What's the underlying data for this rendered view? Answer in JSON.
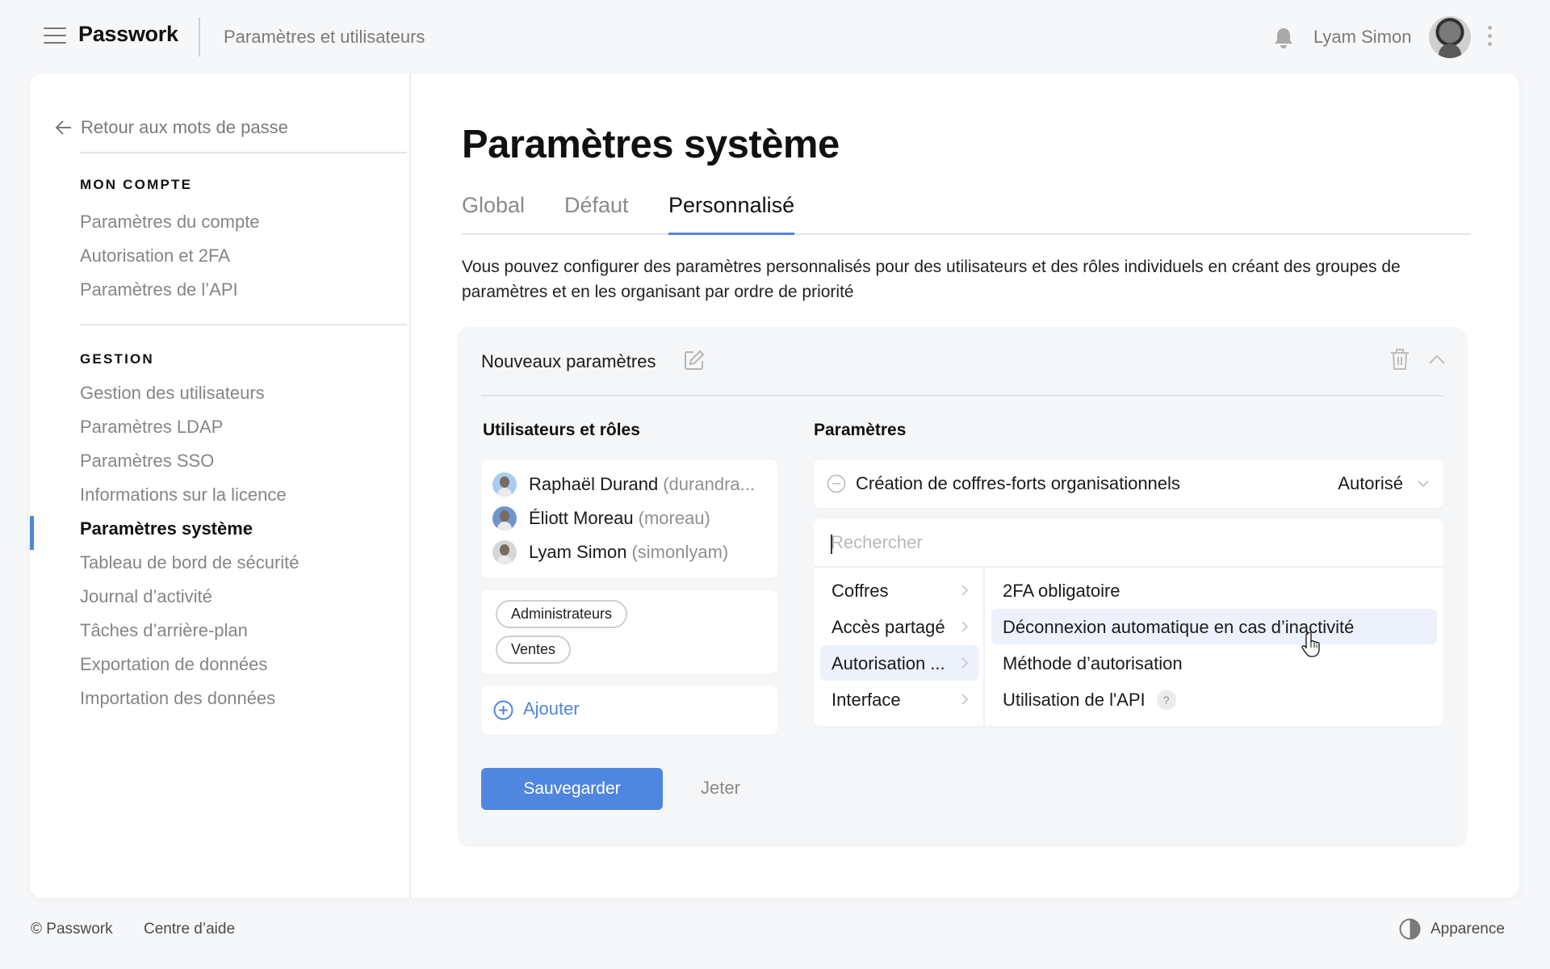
{
  "header": {
    "brand": "Passwork",
    "breadcrumb": "Paramètres et utilisateurs",
    "user_name": "Lyam Simon"
  },
  "sidebar": {
    "back_label": "Retour aux mots de passe",
    "sections": [
      {
        "title": "MON COMPTE",
        "items": [
          {
            "label": "Paramètres du compte",
            "active": false
          },
          {
            "label": "Autorisation et 2FA",
            "active": false
          },
          {
            "label": "Paramètres de l’API",
            "active": false
          }
        ]
      },
      {
        "title": "GESTION",
        "items": [
          {
            "label": "Gestion des utilisateurs",
            "active": false
          },
          {
            "label": "Paramètres LDAP",
            "active": false
          },
          {
            "label": "Paramètres SSO",
            "active": false
          },
          {
            "label": "Informations sur la licence",
            "active": false
          },
          {
            "label": "Paramètres système",
            "active": true
          },
          {
            "label": "Tableau de bord de sécurité",
            "active": false
          },
          {
            "label": "Journal d’activité",
            "active": false
          },
          {
            "label": "Tâches d’arrière-plan",
            "active": false
          },
          {
            "label": "Exportation de données",
            "active": false
          },
          {
            "label": "Importation des données",
            "active": false
          }
        ]
      }
    ]
  },
  "main": {
    "title": "Paramètres système",
    "tabs": [
      {
        "label": "Global",
        "active": false
      },
      {
        "label": "Défaut",
        "active": false
      },
      {
        "label": "Personnalisé",
        "active": true
      }
    ],
    "description": "Vous pouvez configurer des paramètres personnalisés pour des utilisateurs et des rôles individuels en créant des groupes de paramètres et en les organisant par ordre de priorité",
    "group": {
      "title": "Nouveaux paramètres",
      "users_heading": "Utilisateurs et rôles",
      "users": [
        {
          "name": "Raphaël Durand",
          "login": "(durandra...",
          "avatar_color": "#a9cdf0"
        },
        {
          "name": "Éliott Moreau",
          "login": "(moreau)",
          "avatar_color": "#6f95cc"
        },
        {
          "name": "Lyam Simon",
          "login": "(simonlyam)",
          "avatar_color": "#d6d6d6"
        }
      ],
      "roles": [
        "Administrateurs",
        "Ventes"
      ],
      "add_label": "Ajouter",
      "settings_heading": "Paramètres",
      "setting": {
        "label": "Création de coffres-forts organisationnels",
        "value": "Autorisé"
      },
      "search_placeholder": "Rechercher",
      "search_value": "",
      "categories": [
        {
          "label": "Coffres",
          "active": false
        },
        {
          "label": "Accès partagé",
          "active": false
        },
        {
          "label": "Autorisation ...",
          "active": true
        },
        {
          "label": "Interface",
          "active": false
        }
      ],
      "options": [
        {
          "label": "2FA obligatoire",
          "hover": false,
          "help": false
        },
        {
          "label": "Déconnexion automatique en cas d’inactivité",
          "hover": true,
          "help": false
        },
        {
          "label": "Méthode d’autorisation",
          "hover": false,
          "help": false
        },
        {
          "label": "Utilisation de l'API",
          "hover": false,
          "help": true
        }
      ],
      "help_glyph": "?",
      "save_label": "Sauvegarder",
      "discard_label": "Jeter"
    }
  },
  "footer": {
    "copyright": "© Passwork",
    "help_center": "Centre d’aide",
    "appearance": "Apparence"
  },
  "colors": {
    "accent": "#4f86e0",
    "highlight": "#edf1fb",
    "background": "#f6f7f9"
  }
}
